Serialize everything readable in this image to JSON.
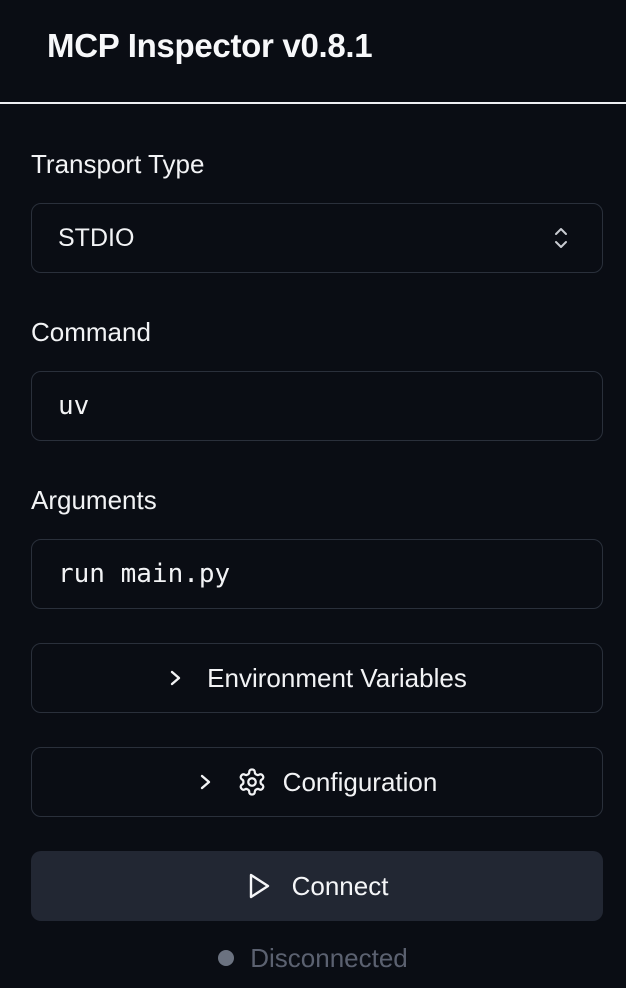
{
  "header": {
    "title": "MCP Inspector v0.8.1"
  },
  "transport": {
    "label": "Transport Type",
    "selected": "STDIO",
    "icon": "chevron-up-down-icon"
  },
  "command": {
    "label": "Command",
    "value": "uv"
  },
  "arguments": {
    "label": "Arguments",
    "value": "run main.py"
  },
  "env_section": {
    "label": "Environment Variables",
    "icon": "chevron-right-icon"
  },
  "config_section": {
    "label": "Configuration",
    "icons": [
      "chevron-right-icon",
      "gear-icon"
    ]
  },
  "connect": {
    "label": "Connect",
    "icon": "play-icon"
  },
  "status": {
    "text": "Disconnected",
    "dot_color": "#6b7280"
  },
  "colors": {
    "background": "#0a0d14",
    "border": "#2a303b",
    "button_bg": "#222733",
    "muted_text": "#5b6170"
  }
}
